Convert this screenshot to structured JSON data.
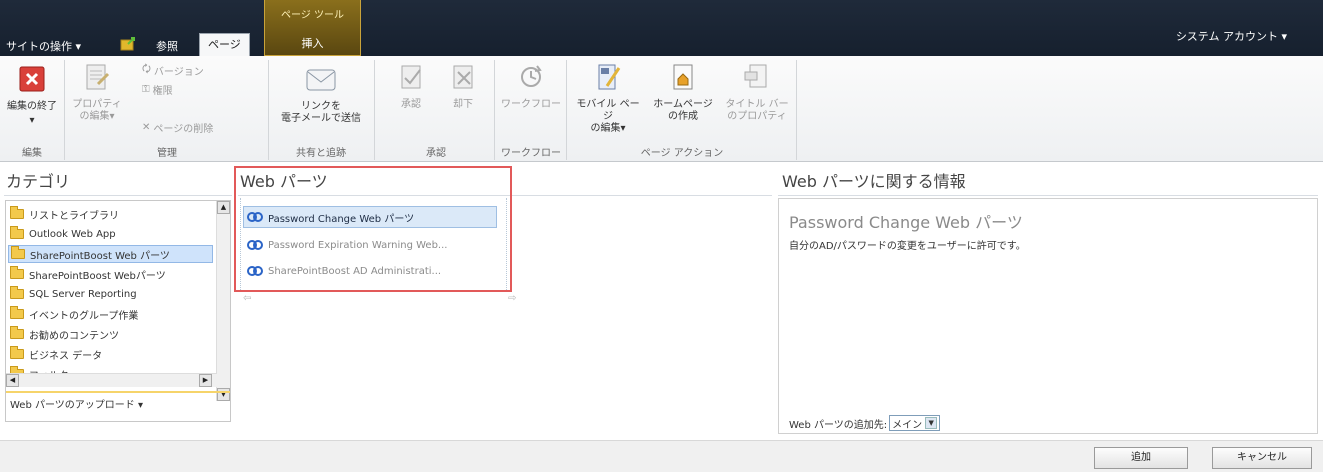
{
  "topbar": {
    "site_actions": "サイトの操作 ▾",
    "browse": "参照",
    "page_tab": "ページ",
    "tools_title": "ページ ツール",
    "insert_tab": "挿入",
    "user_menu": "システム アカウント ▾"
  },
  "ribbon": {
    "stop_editing": "編集の終了",
    "properties_line1": "プロパティ",
    "properties_line2": "の編集▾",
    "version": "バージョン",
    "permissions": "権限",
    "delete_page": "ページの削除",
    "email_link_line1": "リンクを",
    "email_link_line2": "電子メールで送信",
    "approve": "承認",
    "reject": "却下",
    "workflow": "ワークフロー",
    "mobile_line1": "モバイル ページ",
    "mobile_line2": "の編集▾",
    "homepage_line1": "ホームページ",
    "homepage_line2": "の作成",
    "titlebar_line1": "タイトル バー",
    "titlebar_line2": "のプロパティ",
    "groups": {
      "edit": "編集",
      "manage": "管理",
      "share": "共有と追跡",
      "approval": "承認",
      "workflow": "ワークフロー",
      "page_actions": "ページ アクション"
    }
  },
  "headings": {
    "category": "カテゴリ",
    "webparts": "Web パーツ",
    "about": "Web パーツに関する情報"
  },
  "categories": [
    "リストとライブラリ",
    "Outlook Web App",
    "SharePointBoost Web パーツ",
    "SharePointBoost Webパーツ",
    "SQL Server Reporting",
    "イベントのグループ作業",
    "お勧めのコンテンツ",
    "ビジネス データ",
    "フィルター"
  ],
  "upload": "Web パーツのアップロード ▾",
  "webparts": [
    "Password Change Web パーツ",
    "Password Expiration Warning Web...",
    "SharePointBoost AD Administrati..."
  ],
  "info": {
    "title": "Password Change Web パーツ",
    "description": "自分のAD/パスワードの変更をユーザーに許可です。",
    "add_to_label": "Web パーツの追加先:",
    "add_to_value": "メイン"
  },
  "footer": {
    "add": "追加",
    "cancel": "キャンセル"
  },
  "colors": {
    "topbar": "#1f2a3a",
    "context_tab": "#8a6f1c",
    "highlight_border": "#e25959",
    "selection": "#cfe3fb"
  }
}
